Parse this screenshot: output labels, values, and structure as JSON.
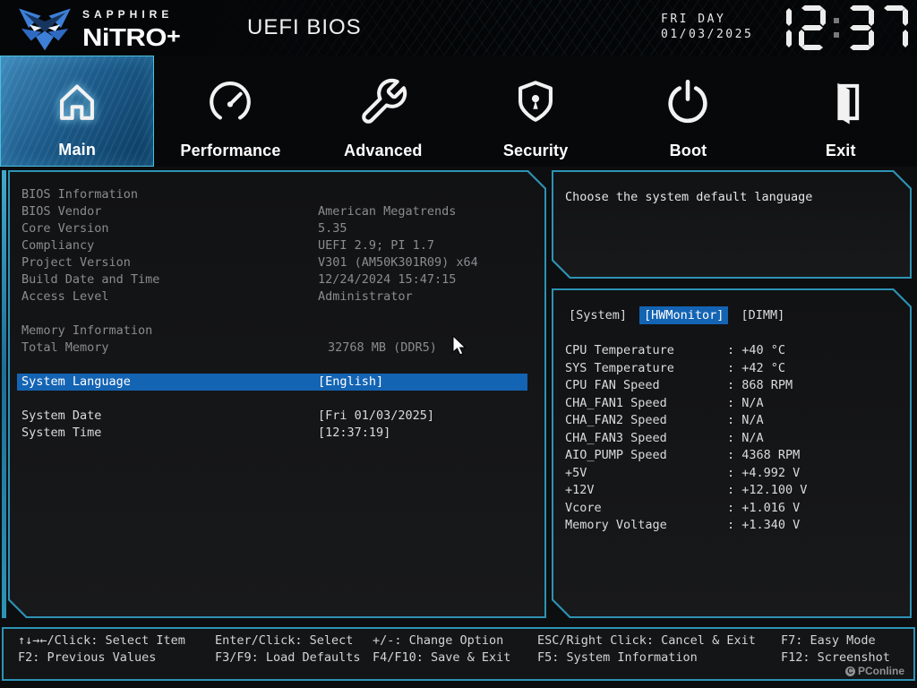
{
  "colors": {
    "accent": "#2d93b4",
    "highlight": "#1464b4",
    "clock": "#ededed"
  },
  "header": {
    "brand_top": "SAPPHIRE",
    "brand_main": "NiTRO",
    "brand_plus": "+",
    "title": "UEFI BIOS",
    "date_line1": "FRI DAY",
    "date_line2": "01/03/2025",
    "time": "12:37"
  },
  "nav": {
    "tabs": [
      {
        "label": "Main",
        "icon": "home-icon",
        "active": true
      },
      {
        "label": "Performance",
        "icon": "gauge-icon",
        "active": false
      },
      {
        "label": "Advanced",
        "icon": "wrench-icon",
        "active": false
      },
      {
        "label": "Security",
        "icon": "shield-icon",
        "active": false
      },
      {
        "label": "Boot",
        "icon": "power-icon",
        "active": false
      },
      {
        "label": "Exit",
        "icon": "door-icon",
        "active": false
      }
    ]
  },
  "main_panel": {
    "rows": [
      {
        "type": "section",
        "label": "BIOS Information"
      },
      {
        "type": "info",
        "label": "BIOS Vendor",
        "value": "American Megatrends"
      },
      {
        "type": "info",
        "label": "Core Version",
        "value": "5.35"
      },
      {
        "type": "info",
        "label": "Compliancy",
        "value": "UEFI 2.9; PI 1.7"
      },
      {
        "type": "info",
        "label": "Project Version",
        "value": "V301 (AM50K301R09) x64"
      },
      {
        "type": "info",
        "label": "Build Date and Time",
        "value": "12/24/2024 15:47:15"
      },
      {
        "type": "info",
        "label": "Access Level",
        "value": "Administrator"
      },
      {
        "type": "spacer"
      },
      {
        "type": "section",
        "label": "Memory Information"
      },
      {
        "type": "info",
        "label": "Total Memory",
        "value": "32768 MB (DDR5)",
        "indent": true
      },
      {
        "type": "spacer"
      },
      {
        "type": "option",
        "label": "System Language",
        "value": "[English]",
        "selected": true
      },
      {
        "type": "spacer"
      },
      {
        "type": "option",
        "label": "System Date",
        "value": "[Fri 01/03/2025]"
      },
      {
        "type": "option",
        "label": "System Time",
        "value": "[12:37:19]"
      }
    ]
  },
  "help_panel": {
    "text": "Choose the system default language"
  },
  "monitor_panel": {
    "tabs": [
      {
        "label": "[System]",
        "active": false
      },
      {
        "label": "[HWMonitor]",
        "active": true
      },
      {
        "label": "[DIMM]",
        "active": false
      }
    ],
    "rows": [
      {
        "label": "CPU Temperature",
        "value": "+40 °C"
      },
      {
        "label": "SYS Temperature",
        "value": "+42 °C"
      },
      {
        "label": "CPU FAN Speed",
        "value": "868 RPM"
      },
      {
        "label": "CHA_FAN1 Speed",
        "value": "N/A"
      },
      {
        "label": "CHA_FAN2 Speed",
        "value": "N/A"
      },
      {
        "label": "CHA_FAN3 Speed",
        "value": "N/A"
      },
      {
        "label": "AIO_PUMP Speed",
        "value": "4368 RPM"
      },
      {
        "label": "+5V",
        "value": "+4.992 V"
      },
      {
        "label": "+12V",
        "value": "+12.100 V"
      },
      {
        "label": "Vcore",
        "value": "+1.016 V"
      },
      {
        "label": "Memory Voltage",
        "value": "+1.340 V"
      }
    ]
  },
  "footer": {
    "row1": [
      "↑↓→←/Click: Select Item",
      "Enter/Click: Select",
      "+/-: Change Option",
      "ESC/Right Click: Cancel & Exit",
      "F7: Easy Mode"
    ],
    "row2": [
      "F2: Previous Values",
      "F3/F9: Load Defaults",
      "F4/F10: Save & Exit",
      "F5: System Information",
      "F12: Screenshot"
    ],
    "watermark": "PConline"
  }
}
